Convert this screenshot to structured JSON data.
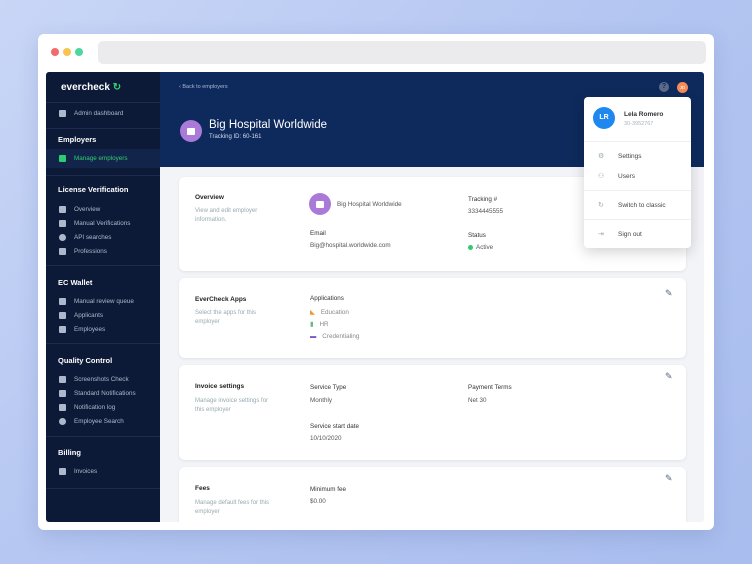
{
  "sidebar": {
    "logo": "evercheck",
    "admin_dashboard": "Admin dashboard",
    "sections": [
      {
        "title": "Employers",
        "items": [
          "Manage employers"
        ]
      },
      {
        "title": "License Verification",
        "items": [
          "Overview",
          "Manual Verifications",
          "API searches",
          "Professions"
        ]
      },
      {
        "title": "EC Wallet",
        "items": [
          "Manual review queue",
          "Applicants",
          "Employees"
        ]
      },
      {
        "title": "Quality Control",
        "items": [
          "Screenshots Check",
          "Standard Notifications",
          "Notification log",
          "Employee Search"
        ]
      },
      {
        "title": "Billing",
        "items": [
          "Invoices"
        ]
      }
    ]
  },
  "header": {
    "back": "‹ Back to employers",
    "title": "Big Hospital Worldwide",
    "tracking": "Tracking ID: 60-161",
    "help": "?",
    "user_initials": "JD"
  },
  "user_menu": {
    "initials": "LR",
    "name": "Lela Romero",
    "id": "30-3952767",
    "items": [
      "Settings",
      "Users",
      "Switch to classic",
      "Sign out"
    ]
  },
  "overview": {
    "title": "Overview",
    "desc": "View and edit employer information.",
    "name": "Big Hospital Worldwide",
    "email_label": "Email",
    "email": "Big@hospital.worldwide.com",
    "tracking_label": "Tracking #",
    "tracking": "3334445555",
    "status_label": "Status",
    "status": "Active",
    "status_color": "#2ecc71"
  },
  "apps": {
    "title": "EverCheck Apps",
    "desc": "Select the apps for this employer",
    "label": "Applications",
    "items": [
      "Education",
      "HR",
      "Credentialing"
    ]
  },
  "invoice": {
    "title": "Invoice settings",
    "desc": "Manage invoice settings for this employer",
    "service_type_label": "Service Type",
    "service_type": "Monthly",
    "payment_terms_label": "Payment Terms",
    "payment_terms": "Net 30",
    "start_label": "Service start date",
    "start": "10/10/2020"
  },
  "fees": {
    "title": "Fees",
    "desc": "Manage default fees for this employer",
    "min_label": "Minimum fee",
    "min": "$0.00"
  }
}
